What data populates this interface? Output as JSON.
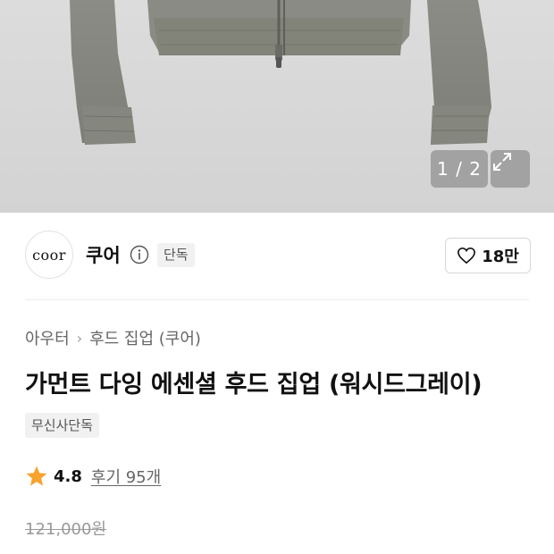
{
  "gallery": {
    "pager_text": "1 / 2",
    "expand_icon": "expand-icon",
    "image_alt": "product-hoodie-image"
  },
  "brand": {
    "logo_text": "coor",
    "name": "쿠어",
    "info_icon": "info-icon",
    "exclusive_badge": "단독",
    "like_icon": "heart-icon",
    "like_count": "18만"
  },
  "product": {
    "breadcrumb": [
      "아우터",
      "후드 집업 (쿠어)"
    ],
    "breadcrumb_sep_icon": "chevron-right-icon",
    "title": "가먼트 다잉 에센셜 후드 집업 (워시드그레이)",
    "musinsa_badge": "무신사단독",
    "rating_icon": "star-icon",
    "rating": "4.8",
    "reviews": "후기 95개",
    "original_price": "121,000원",
    "sale_price": "..."
  },
  "colors": {
    "star": "#f7a32e",
    "sale": "#ff3b30"
  }
}
